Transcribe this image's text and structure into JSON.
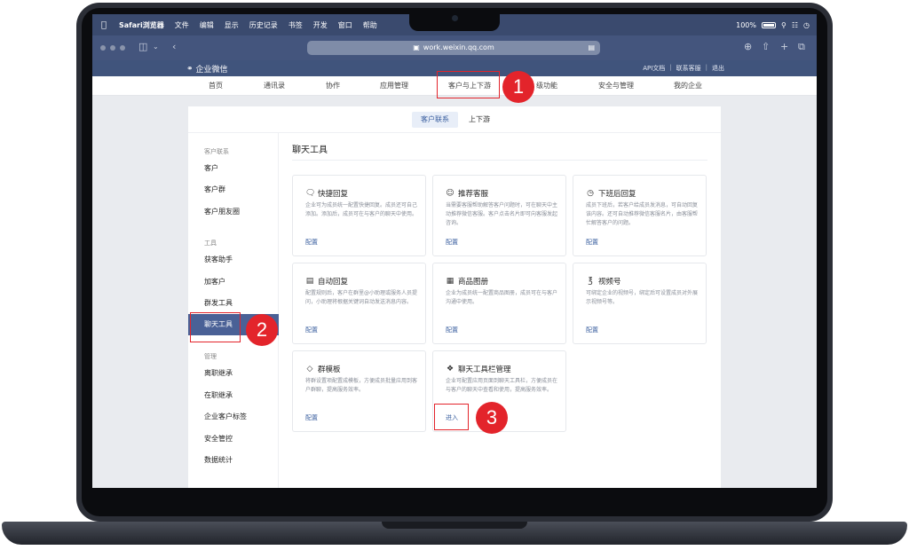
{
  "menubar": {
    "app": "Safari浏览器",
    "items": [
      "文件",
      "编辑",
      "显示",
      "历史记录",
      "书签",
      "开发",
      "窗口",
      "帮助"
    ],
    "battery": "100%"
  },
  "safari": {
    "url": "work.weixin.qq.com"
  },
  "wecom": {
    "logo": "企业微信",
    "links": [
      "API文档",
      "联系客服",
      "退出"
    ]
  },
  "nav": {
    "tabs": [
      "首页",
      "通讯录",
      "协作",
      "应用管理",
      "客户与上下游",
      "级功能",
      "安全与管理",
      "我的企业"
    ]
  },
  "subtabs": [
    "客户联系",
    "上下游"
  ],
  "sidebar": {
    "groups": [
      "客户联系",
      "工具",
      "管理"
    ],
    "customer": [
      "客户",
      "客户群",
      "客户朋友圈"
    ],
    "tools": [
      "获客助手",
      "加客户",
      "群发工具",
      "聊天工具"
    ],
    "manage": [
      "离职继承",
      "在职继承",
      "企业客户标签",
      "安全管控",
      "数据统计"
    ]
  },
  "content": {
    "title": "聊天工具",
    "cards": [
      {
        "title": "快捷回复",
        "icon": "chat-bubble-icon",
        "desc": "企业可为成员统一配置快捷回复。成员还可自己添加。添加后，成员可在与客户的聊天中使用。",
        "link": "配置"
      },
      {
        "title": "推荐客服",
        "icon": "service-icon",
        "desc": "当需要客服帮助解答客户问题时，可在聊天中主动推荐微信客服。客户点击名片即可向客服发起咨询。",
        "link": "配置"
      },
      {
        "title": "下班后回复",
        "icon": "clock-message-icon",
        "desc": "成员下班后，若客户给成员发消息，可自动回复该内容。还可自动推荐微信客服名片，由客服帮忙解答客户的问题。",
        "link": "配置"
      },
      {
        "title": "自动回复",
        "icon": "auto-reply-icon",
        "desc": "配置规则后，客户在群里@小助理或服务人员提问，小助理将根据关键词自动发送消息内容。",
        "link": "配置"
      },
      {
        "title": "商品图册",
        "icon": "catalog-icon",
        "desc": "企业为成员统一配置商品图册，成员可在与客户沟通中使用。",
        "link": "配置"
      },
      {
        "title": "视频号",
        "icon": "channels-icon",
        "desc": "可绑定企业的视频号，绑定后可设置成员对外展示视频号等。",
        "link": "配置"
      },
      {
        "title": "群模板",
        "icon": "template-icon",
        "desc": "将群设置项配置成模板，方便成员批量应用到客户群聊，提高服务效率。",
        "link": "配置"
      },
      {
        "title": "聊天工具栏管理",
        "icon": "toolbar-icon",
        "desc": "企业可配置应用页面到聊天工具栏，方便成员在与客户的聊天中查看和使用，提高服务效率。",
        "link": "进入"
      }
    ]
  },
  "annotations": {
    "step1": "1",
    "step2": "2",
    "step3": "3"
  },
  "colors": {
    "accent": "#3a5f9f",
    "header": "#40547c",
    "annotation": "#e3242b"
  }
}
